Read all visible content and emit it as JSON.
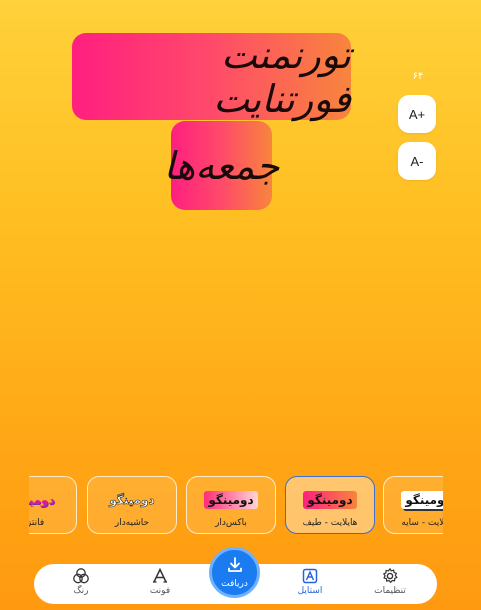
{
  "headline": {
    "line1": "تورنمنت فورتنایت",
    "line2": "جمعه‌ها"
  },
  "size_controls": {
    "value": "۶۴",
    "increase_label": "A+",
    "decrease_label": "A-"
  },
  "style_cards": [
    {
      "label": "فانتزی",
      "preview": "دومینگو",
      "selected": false
    },
    {
      "label": "حاشیه‌دار",
      "preview": "دومینگو",
      "selected": false
    },
    {
      "label": "باکس‌دار",
      "preview": "دومینگو",
      "selected": false
    },
    {
      "label": "هایلایت - طیف",
      "preview": "دومینگو",
      "selected": true
    },
    {
      "label": "هایلایت - سایه",
      "preview": "دومینگو",
      "selected": false
    }
  ],
  "bottom_nav": {
    "color": "رنگ",
    "font": "فونت",
    "download": "دریافت",
    "style": "استایل",
    "settings": "تنظیمات"
  },
  "colors": {
    "accent": "#1a7cf0",
    "gradient_start": "#ff1f7f",
    "gradient_end": "#f8853c"
  }
}
